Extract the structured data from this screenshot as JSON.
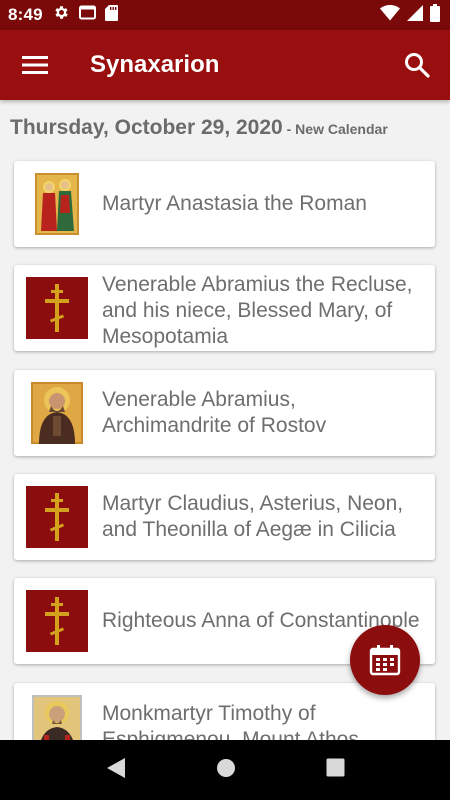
{
  "status_bar": {
    "time": "8:49"
  },
  "app_bar": {
    "title": "Synaxarion"
  },
  "date_header": {
    "date": "Thursday, October 29, 2020",
    "calendar": " - New Calendar"
  },
  "saints": [
    {
      "name": "Martyr Anastasia the Roman",
      "thumb": "icon-image"
    },
    {
      "name": "Venerable Abramius the Recluse, and his niece, Blessed Mary, of Mesopotamia",
      "thumb": "cross-icon"
    },
    {
      "name": "Venerable Abramius, Archimandrite of Rostov",
      "thumb": "icon-image"
    },
    {
      "name": "Martyr Claudius, Asterius, Neon, and Theonilla of Aegæ in Cilicia",
      "thumb": "cross-icon"
    },
    {
      "name": "Righteous Anna of Constantinople",
      "thumb": "cross-icon"
    },
    {
      "name": "Monkmartyr Timothy of Esphigmenou, Mount Athos",
      "thumb": "icon-image"
    }
  ],
  "colors": {
    "primary": "#990f0f",
    "status": "#7a0a0a",
    "cross_bg": "#8c0d0d",
    "cross": "#d4a21c",
    "text": "#6e6e6e"
  }
}
